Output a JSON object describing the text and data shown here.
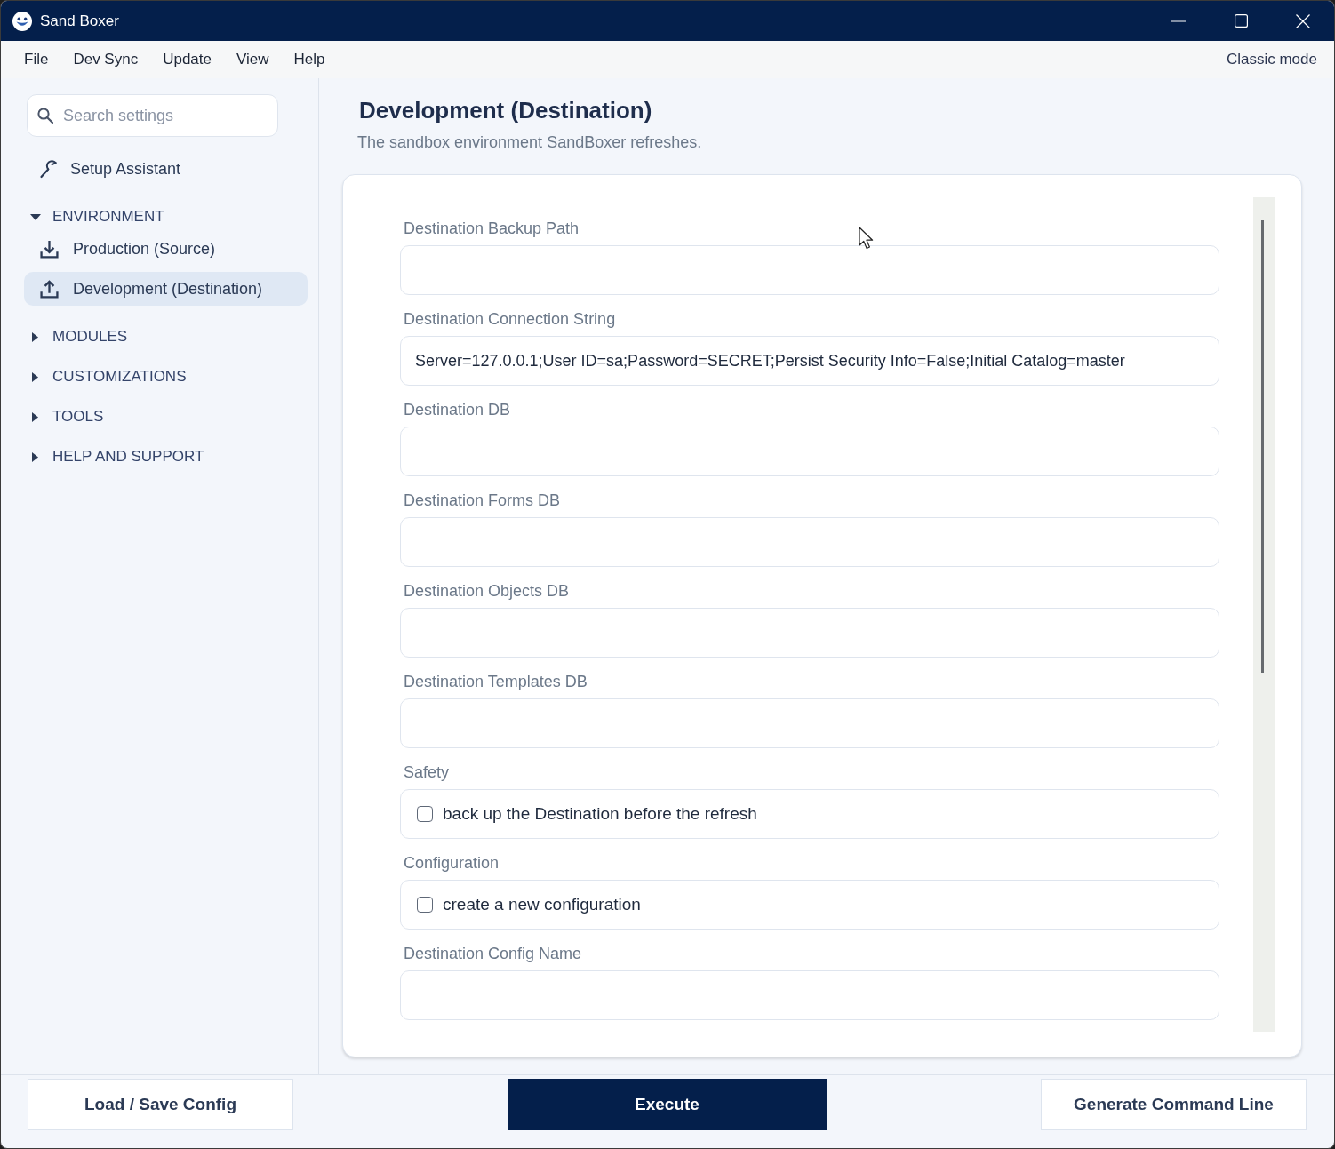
{
  "window": {
    "title": "Sand Boxer"
  },
  "menu": {
    "items": [
      "File",
      "Dev Sync",
      "Update",
      "View",
      "Help"
    ],
    "mode_link": "Classic mode"
  },
  "sidebar": {
    "search": {
      "placeholder": "Search settings"
    },
    "assistant": {
      "label": "Setup Assistant",
      "selected": false
    },
    "sections": [
      {
        "label": "ENVIRONMENT",
        "expanded": true,
        "children": [
          {
            "label": "Production (Source)",
            "kind": "download",
            "selected": false
          },
          {
            "label": "Development (Destination)",
            "kind": "upload",
            "selected": true
          }
        ]
      },
      {
        "label": "MODULES",
        "expanded": false
      },
      {
        "label": "CUSTOMIZATIONS",
        "expanded": false
      },
      {
        "label": "TOOLS",
        "expanded": false
      },
      {
        "label": "HELP AND SUPPORT",
        "expanded": false
      }
    ]
  },
  "page": {
    "title": "Development (Destination)",
    "subtitle": "The sandbox environment SandBoxer refreshes."
  },
  "form": {
    "fields": [
      {
        "kind": "text",
        "label": "Destination Backup Path"
      },
      {
        "kind": "text",
        "label": "Destination Connection String",
        "value": "Server=127.0.0.1;User ID=sa;Password=SECRET;Persist Security Info=False;Initial Catalog=master"
      },
      {
        "kind": "text",
        "label": "Destination DB"
      },
      {
        "kind": "text",
        "label": "Destination Forms DB"
      },
      {
        "kind": "text",
        "label": "Destination Objects DB"
      },
      {
        "kind": "text",
        "label": "Destination Templates DB"
      },
      {
        "kind": "checkbox",
        "label": "Safety",
        "text": "back up the Destination before the refresh",
        "checked": false
      },
      {
        "kind": "checkbox",
        "label": "Configuration",
        "text": "create a new configuration",
        "checked": false
      },
      {
        "kind": "text",
        "label": "Destination Config Name"
      }
    ]
  },
  "footer": {
    "buttons": [
      {
        "label": "Load / Save Config",
        "kind": "secondary"
      },
      {
        "label": "Execute",
        "kind": "primary"
      },
      {
        "label": "Generate Command Line",
        "kind": "secondary"
      }
    ]
  }
}
